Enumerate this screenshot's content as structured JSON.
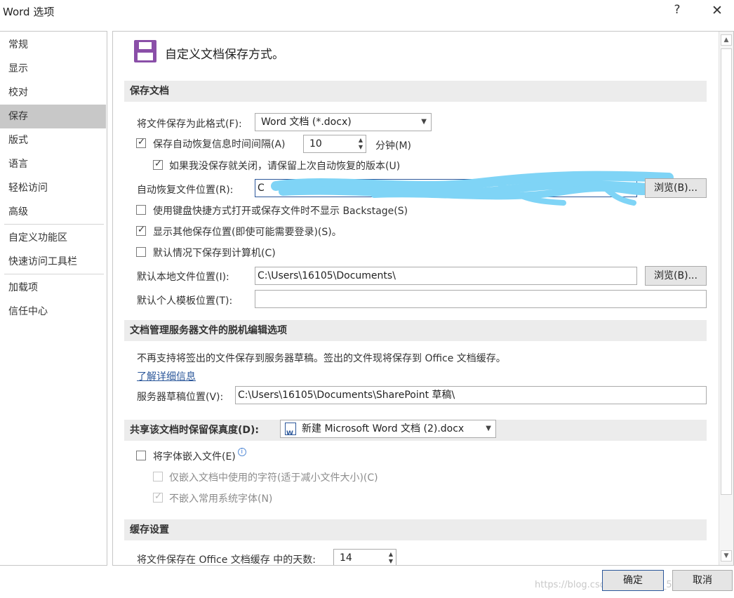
{
  "window": {
    "title": "Word 选项",
    "help": "?",
    "close": "✕"
  },
  "sidebar": {
    "items": [
      {
        "label": "常规"
      },
      {
        "label": "显示"
      },
      {
        "label": "校对"
      },
      {
        "label": "保存"
      },
      {
        "label": "版式"
      },
      {
        "label": "语言"
      },
      {
        "label": "轻松访问"
      },
      {
        "label": "高级"
      },
      {
        "label": "自定义功能区"
      },
      {
        "label": "快速访问工具栏"
      },
      {
        "label": "加载项"
      },
      {
        "label": "信任中心"
      }
    ],
    "active_index": 3
  },
  "heading": "自定义文档保存方式。",
  "save_docs": {
    "section_title": "保存文档",
    "format_label": "将文件保存为此格式(F):",
    "format_value": "Word 文档 (*.docx)",
    "autorecover_label": "保存自动恢复信息时间间隔(A)",
    "autorecover_checked": true,
    "autorecover_minutes": "10",
    "minutes_label": "分钟(M)",
    "keep_last_label": "如果我没保存就关闭，请保留上次自动恢复的版本(U)",
    "keep_last_checked": true,
    "autorecover_location_label": "自动恢复文件位置(R):",
    "autorecover_location_value": "C",
    "browse_label_1": "浏览(B)...",
    "no_backstage_label": "使用键盘快捷方式打开或保存文件时不显示 Backstage(S)",
    "no_backstage_checked": false,
    "show_other_label": "显示其他保存位置(即使可能需要登录)(S)。",
    "show_other_checked": true,
    "save_to_computer_label": "默认情况下保存到计算机(C)",
    "save_to_computer_checked": false,
    "default_local_label": "默认本地文件位置(I):",
    "default_local_value": "C:\\Users\\16105\\Documents\\",
    "browse_label_2": "浏览(B)...",
    "template_label": "默认个人模板位置(T):",
    "template_value": ""
  },
  "offline": {
    "section_title": "文档管理服务器文件的脱机编辑选项",
    "notice": "不再支持将签出的文件保存到服务器草稿。签出的文件现将保存到 Office 文档缓存。",
    "learn_more": "了解详细信息",
    "drafts_label": "服务器草稿位置(V):",
    "drafts_value": "C:\\Users\\16105\\Documents\\SharePoint 草稿\\"
  },
  "fidelity": {
    "section_label": "共享该文档时保留保真度(D):",
    "document_value": "新建 Microsoft Word 文档 (2).docx",
    "embed_fonts_label": "将字体嵌入文件(E)",
    "embed_fonts_checked": false,
    "only_used_label": "仅嵌入文档中使用的字符(适于减小文件大小)(C)",
    "only_used_checked": false,
    "no_common_label": "不嵌入常用系统字体(N)",
    "no_common_checked": true
  },
  "cache": {
    "section_title": "缓存设置",
    "days_label": "将文件保存在 Office 文档缓存 中的天数:",
    "days_value": "14"
  },
  "footer": {
    "ok": "确定",
    "cancel": "取消",
    "watermark": "https://blog.csdn.net/weixin_52411477"
  },
  "colors": {
    "accent": "#2b579a",
    "save_icon": "#8a4fa8",
    "redaction": "#7fd4f6",
    "section_bg": "#ececec",
    "active_nav": "#c8c8c8"
  },
  "icons": {
    "save": "floppy-disk-icon",
    "info": "info-icon",
    "word_doc": "word-doc-icon"
  }
}
